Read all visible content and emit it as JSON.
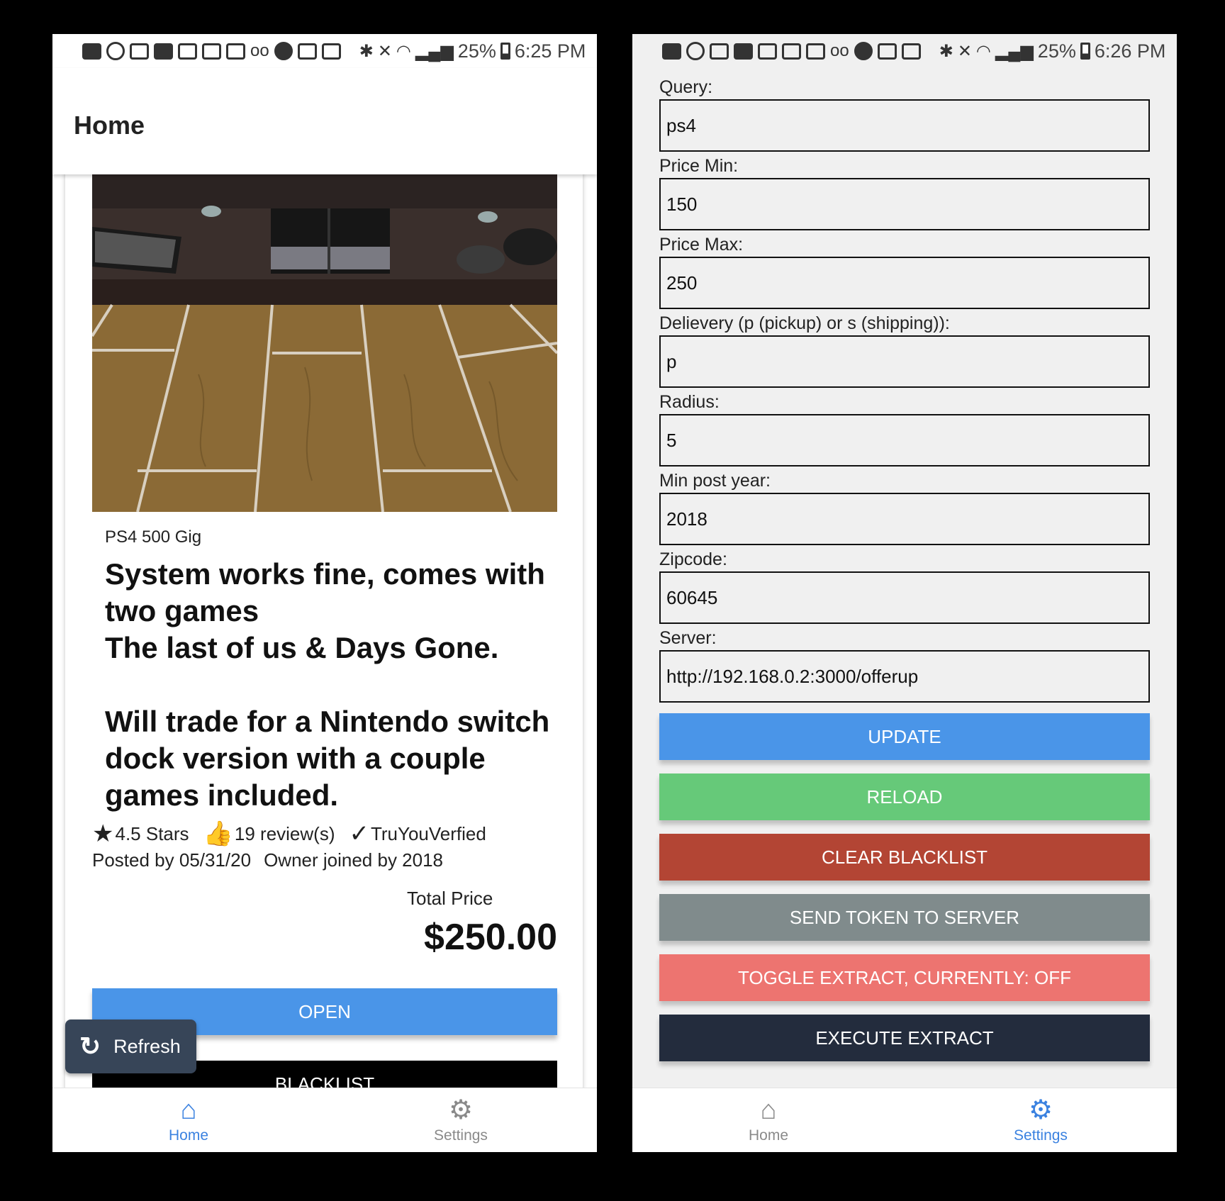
{
  "left": {
    "status": {
      "battery": "25%",
      "time": "6:25 PM"
    },
    "appbar_title": "Home",
    "listing": {
      "title": "PS4 500 Gig",
      "description": "System works fine, comes with two games\nThe last of us & Days Gone.\n\nWill trade for a Nintendo switch dock version with a couple games included.",
      "stars": "4.5 Stars",
      "reviews": "19 review(s)",
      "verified": "TruYouVerfied",
      "posted": "Posted by 05/31/20",
      "owner_joined": "Owner joined by 2018",
      "price_label": "Total Price",
      "price": "$250.00",
      "open_label": "OPEN",
      "blacklist_label": "BLACKLIST"
    },
    "fab_label": "Refresh",
    "nav": {
      "home": "Home",
      "settings": "Settings"
    }
  },
  "right": {
    "status": {
      "battery": "25%",
      "time": "6:26 PM"
    },
    "fields": {
      "query": {
        "label": "Query:",
        "value": "ps4"
      },
      "price_min": {
        "label": "Price Min:",
        "value": "150"
      },
      "price_max": {
        "label": "Price Max:",
        "value": "250"
      },
      "delivery": {
        "label": "Delievery (p (pickup) or s (shipping)):",
        "value": "p"
      },
      "radius": {
        "label": "Radius:",
        "value": "5"
      },
      "min_post_year": {
        "label": "Min post year:",
        "value": "2018"
      },
      "zipcode": {
        "label": "Zipcode:",
        "value": "60645"
      },
      "server": {
        "label": "Server:",
        "value": "http://192.168.0.2:3000/offerup"
      }
    },
    "buttons": {
      "update": "UPDATE",
      "reload": "RELOAD",
      "clear_blacklist": "CLEAR BLACKLIST",
      "send_token": "SEND TOKEN TO SERVER",
      "toggle_extract": "TOGGLE EXTRACT, CURRENTLY: OFF",
      "execute_extract": "EXECUTE EXTRACT"
    },
    "nav": {
      "home": "Home",
      "settings": "Settings"
    }
  },
  "colors": {
    "blue": "#4a95e8",
    "green": "#66c979",
    "red": "#b34534",
    "gray": "#808b8c",
    "salmon": "#ed7470",
    "navy": "#232c3d",
    "nav_active": "#3b82e0"
  }
}
